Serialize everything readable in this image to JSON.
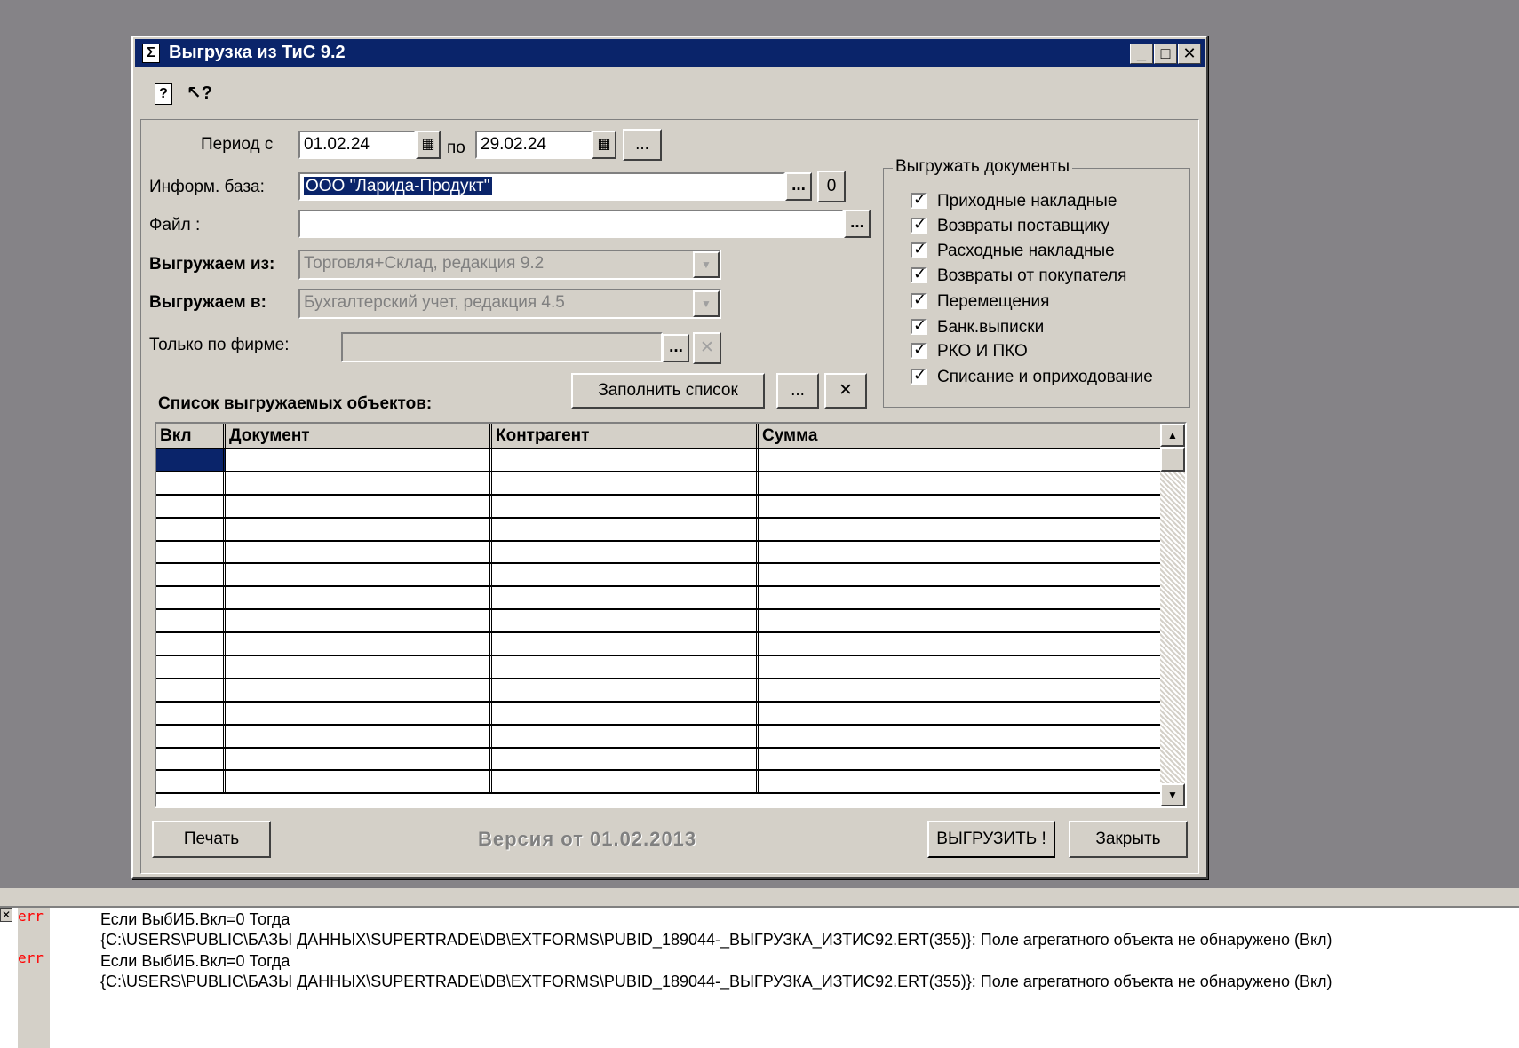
{
  "window": {
    "title": "Выгрузка из ТиС 9.2",
    "icon_glyph": "Σ",
    "controls": {
      "minimize": "_",
      "maximize": "□",
      "close": "✕"
    },
    "toolbar": {
      "help_icon": "?",
      "whatsthis_icon": "↖?"
    }
  },
  "period": {
    "label_from": "Период с",
    "from": "01.02.24",
    "label_to": "по",
    "to": "29.02.24",
    "more_button": "..."
  },
  "infobase": {
    "label": "Информ. база:",
    "value": "ООО \"Ларида-Продукт\"",
    "select_button": "...",
    "clear_button": "0"
  },
  "file": {
    "label": "Файл :",
    "value": "",
    "browse_button": "..."
  },
  "export_from": {
    "label": "Выгружаем из:",
    "value": "Торговля+Склад, редакция 9.2"
  },
  "export_to": {
    "label": "Выгружаем в:",
    "value": "Бухгалтерский учет, редакция 4.5"
  },
  "firm": {
    "label": "Только по фирме:",
    "value": "",
    "select_button": "...",
    "clear_button": "✕"
  },
  "documents_group": {
    "title": "Выгружать документы",
    "items": [
      {
        "label": "Приходные накладные",
        "checked": true
      },
      {
        "label": "Возвраты поставщику",
        "checked": true
      },
      {
        "label": "Расходные накладные",
        "checked": true
      },
      {
        "label": "Возвраты от покупателя",
        "checked": true
      },
      {
        "label": "Перемещения",
        "checked": true
      },
      {
        "label": "Банк.выписки",
        "checked": true
      },
      {
        "label": "РКО И ПКО",
        "checked": true
      },
      {
        "label": "Списание и оприходование",
        "checked": true
      }
    ]
  },
  "list": {
    "title": "Список выгружаемых объектов:",
    "fill_button": "Заполнить список",
    "more_button": "...",
    "clear_button": "✕",
    "columns": [
      "Вкл",
      "Документ",
      "Контрагент",
      "Сумма"
    ],
    "rows": []
  },
  "footer": {
    "print_button": "Печать",
    "version": "Версия от 01.02.2013",
    "export_button": "ВЫГРУЗИТЬ !",
    "close_button": "Закрыть"
  },
  "messages": [
    {
      "tag": "err",
      "line1": "Если ВыбИБ.Вкл=0 Тогда",
      "line2": "{C:\\USERS\\PUBLIC\\БАЗЫ ДАННЫХ\\SUPERTRADE\\DB\\EXTFORMS\\PUBID_189044-_ВЫГРУЗКА_ИЗТИС92.ERT(355)}: Поле агрегатного объекта не обнаружено (Вкл)"
    },
    {
      "tag": "err",
      "line1": "Если ВыбИБ.Вкл=0 Тогда",
      "line2": "{C:\\USERS\\PUBLIC\\БАЗЫ ДАННЫХ\\SUPERTRADE\\DB\\EXTFORMS\\PUBID_189044-_ВЫГРУЗКА_ИЗТИС92.ERT(355)}: Поле агрегатного объекта не обнаружено (Вкл)"
    }
  ],
  "colors": {
    "title_bar": "#0a246a",
    "dialog_bg": "#d4d0c8",
    "desktop": "#858387",
    "error_tag": "#ff0000"
  }
}
